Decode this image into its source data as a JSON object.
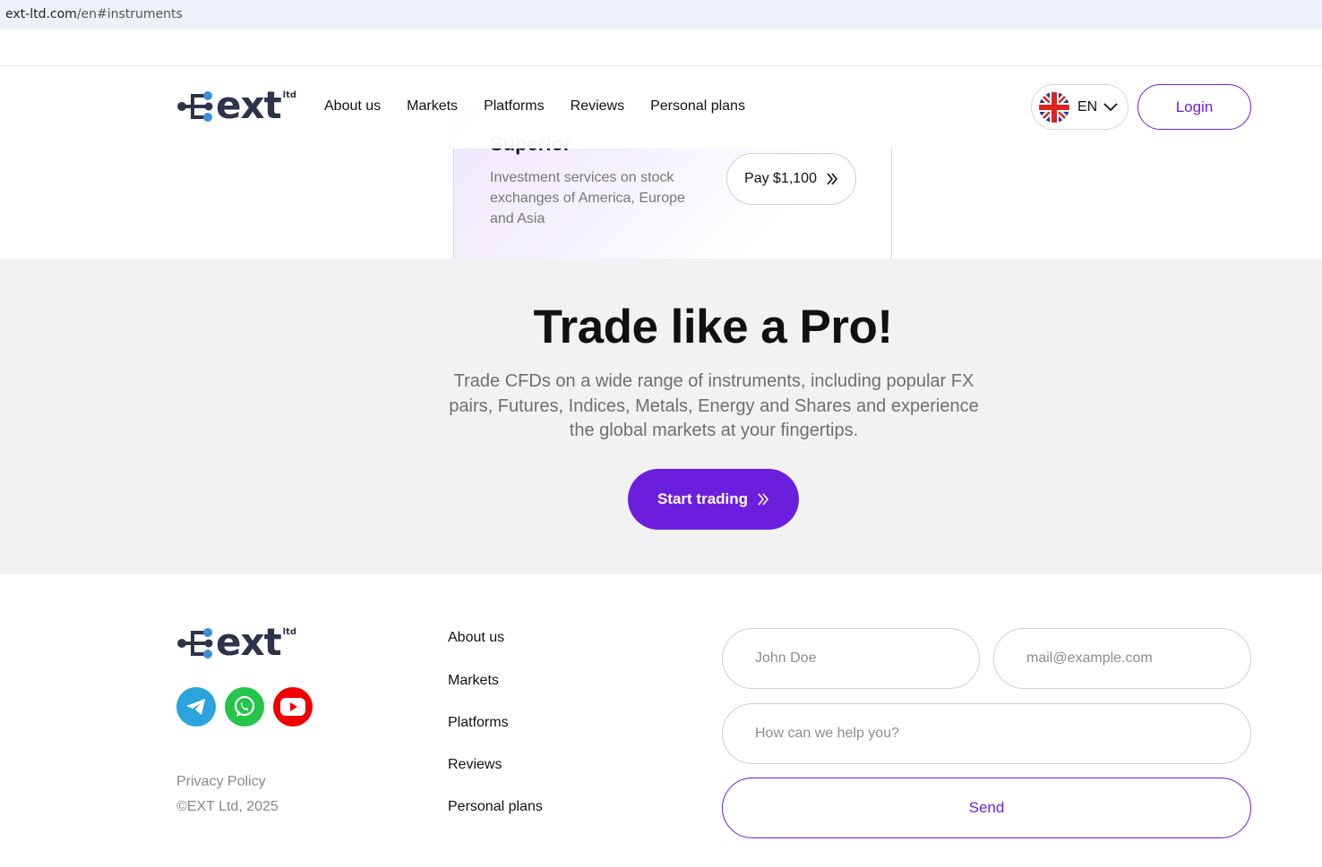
{
  "browser": {
    "url_host": "ext-ltd.com",
    "url_path": "/en#instruments"
  },
  "brand": {
    "name": "ext",
    "suffix": "ltd",
    "accent": "#6b1fdc",
    "logo_dot_color": "#3b8fd9"
  },
  "nav": {
    "items": [
      {
        "label": "About us"
      },
      {
        "label": "Markets"
      },
      {
        "label": "Platforms"
      },
      {
        "label": "Reviews"
      },
      {
        "label": "Personal plans"
      }
    ],
    "language": "EN",
    "login_label": "Login"
  },
  "plan": {
    "title": "Superior",
    "description": "Investment services on stock exchanges of America, Europe and Asia",
    "pay_label": "Pay $1,100"
  },
  "hero": {
    "title": "Trade like a Pro!",
    "subtitle": "Trade CFDs on a wide range of instruments, including popular FX pairs, Futures, Indices, Metals, Energy and Shares and experience the global markets at your fingertips.",
    "cta_label": "Start trading"
  },
  "footer": {
    "social": [
      {
        "name": "telegram-icon",
        "color": "#2aa3de"
      },
      {
        "name": "whatsapp-icon",
        "color": "#25c44a"
      },
      {
        "name": "youtube-icon",
        "color": "#f00000"
      }
    ],
    "privacy_label": "Privacy Policy",
    "copyright": "©EXT Ltd, 2025",
    "links": [
      {
        "label": "About us"
      },
      {
        "label": "Markets"
      },
      {
        "label": "Platforms"
      },
      {
        "label": "Reviews"
      },
      {
        "label": "Personal plans"
      }
    ],
    "form": {
      "name_placeholder": "John Doe",
      "email_placeholder": "mail@example.com",
      "message_placeholder": "How can we help you?",
      "send_label": "Send"
    }
  }
}
